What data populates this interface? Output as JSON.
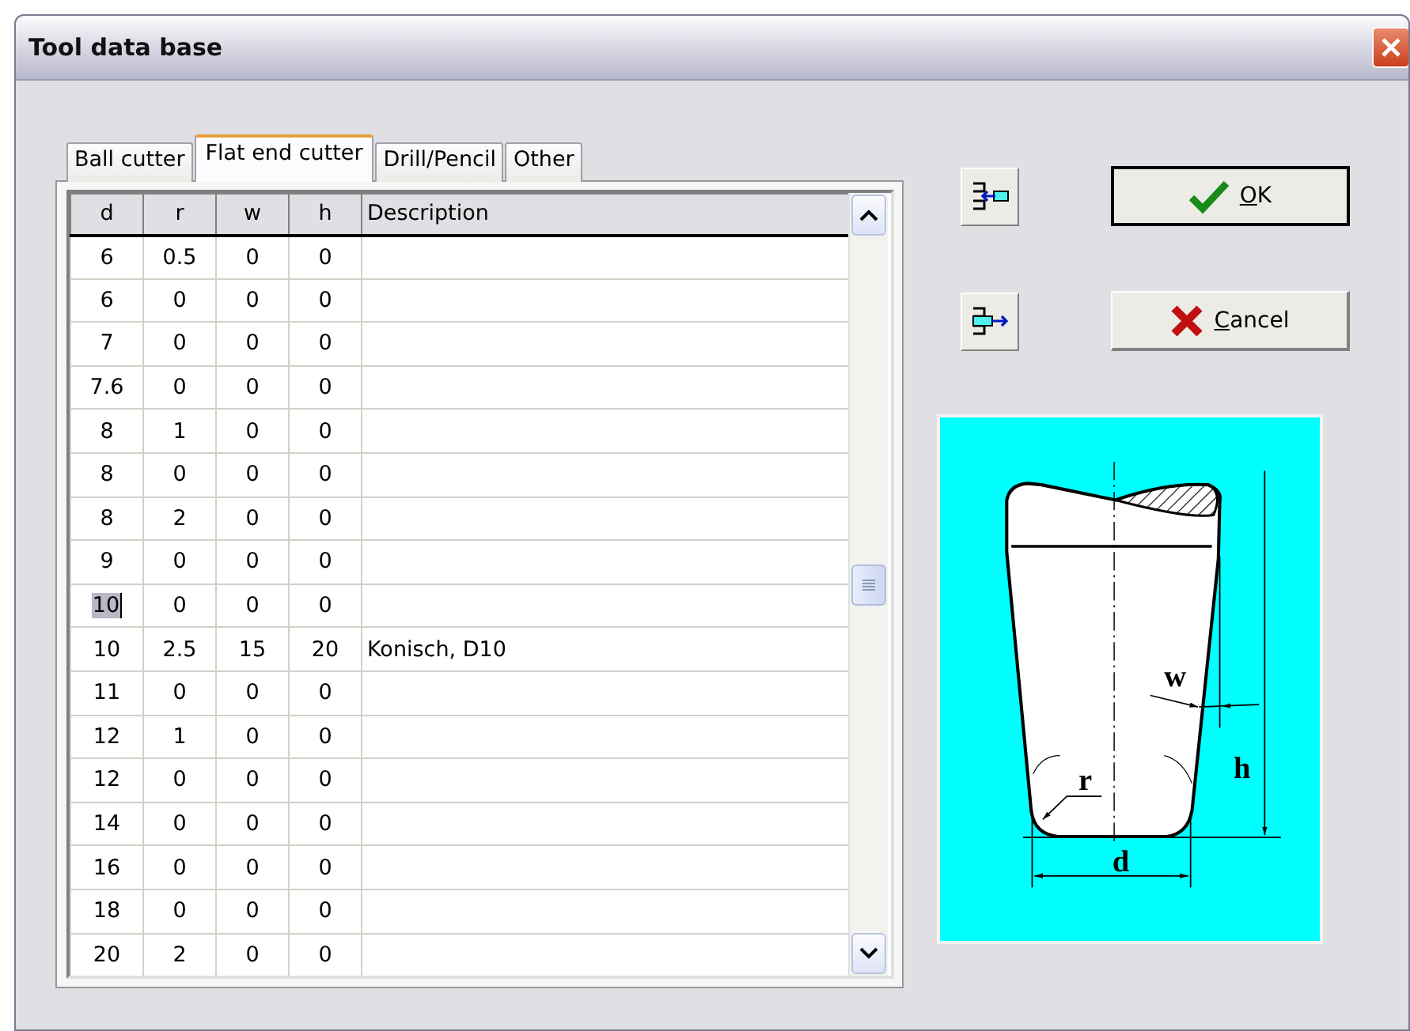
{
  "window": {
    "title": "Tool data base"
  },
  "tabs": [
    {
      "label": "Ball cutter",
      "selected": false
    },
    {
      "label": "Flat end cutter",
      "selected": true
    },
    {
      "label": "Drill/Pencil",
      "selected": false
    },
    {
      "label": "Other",
      "selected": false
    }
  ],
  "table": {
    "columns": [
      "d",
      "r",
      "w",
      "h",
      "Description"
    ],
    "rows": [
      {
        "cells": [
          "6",
          "0.5",
          "0",
          "0"
        ],
        "selected": false
      },
      {
        "cells": [
          "6",
          "0",
          "0",
          "0"
        ],
        "selected": false
      },
      {
        "cells": [
          "7",
          "0",
          "0",
          "0"
        ],
        "selected": false
      },
      {
        "cells": [
          "7.6",
          "0",
          "0",
          "0"
        ],
        "selected": false
      },
      {
        "cells": [
          "8",
          "1",
          "0",
          "0"
        ],
        "selected": false
      },
      {
        "cells": [
          "8",
          "0",
          "0",
          "0"
        ],
        "selected": false
      },
      {
        "cells": [
          "8",
          "2",
          "0",
          "0"
        ],
        "selected": false
      },
      {
        "cells": [
          "9",
          "0",
          "0",
          "0"
        ],
        "selected": false
      },
      {
        "cells": [
          "10",
          "0",
          "0",
          "0"
        ],
        "selected": true
      },
      {
        "cells": [
          "10",
          "2.5",
          "15",
          "20",
          "Konisch, D10"
        ],
        "selected": false
      },
      {
        "cells": [
          "11",
          "0",
          "0",
          "0"
        ],
        "selected": false
      },
      {
        "cells": [
          "12",
          "1",
          "0",
          "0"
        ],
        "selected": false
      },
      {
        "cells": [
          "12",
          "0",
          "0",
          "0"
        ],
        "selected": false
      },
      {
        "cells": [
          "14",
          "0",
          "0",
          "0"
        ],
        "selected": false
      },
      {
        "cells": [
          "16",
          "0",
          "0",
          "0"
        ],
        "selected": false
      },
      {
        "cells": [
          "18",
          "0",
          "0",
          "0"
        ],
        "selected": false
      },
      {
        "cells": [
          "20",
          "2",
          "0",
          "0"
        ],
        "selected": false
      }
    ]
  },
  "buttons": [
    {
      "kind": "ok",
      "label": "OK",
      "default": true
    },
    {
      "kind": "cancel",
      "label": "Cancel",
      "default": false
    }
  ],
  "diagram": {
    "labels": [
      {
        "kind": "w",
        "text": "w"
      },
      {
        "kind": "h",
        "text": "h"
      },
      {
        "kind": "r",
        "text": "r"
      },
      {
        "kind": "d",
        "text": "d"
      }
    ]
  }
}
